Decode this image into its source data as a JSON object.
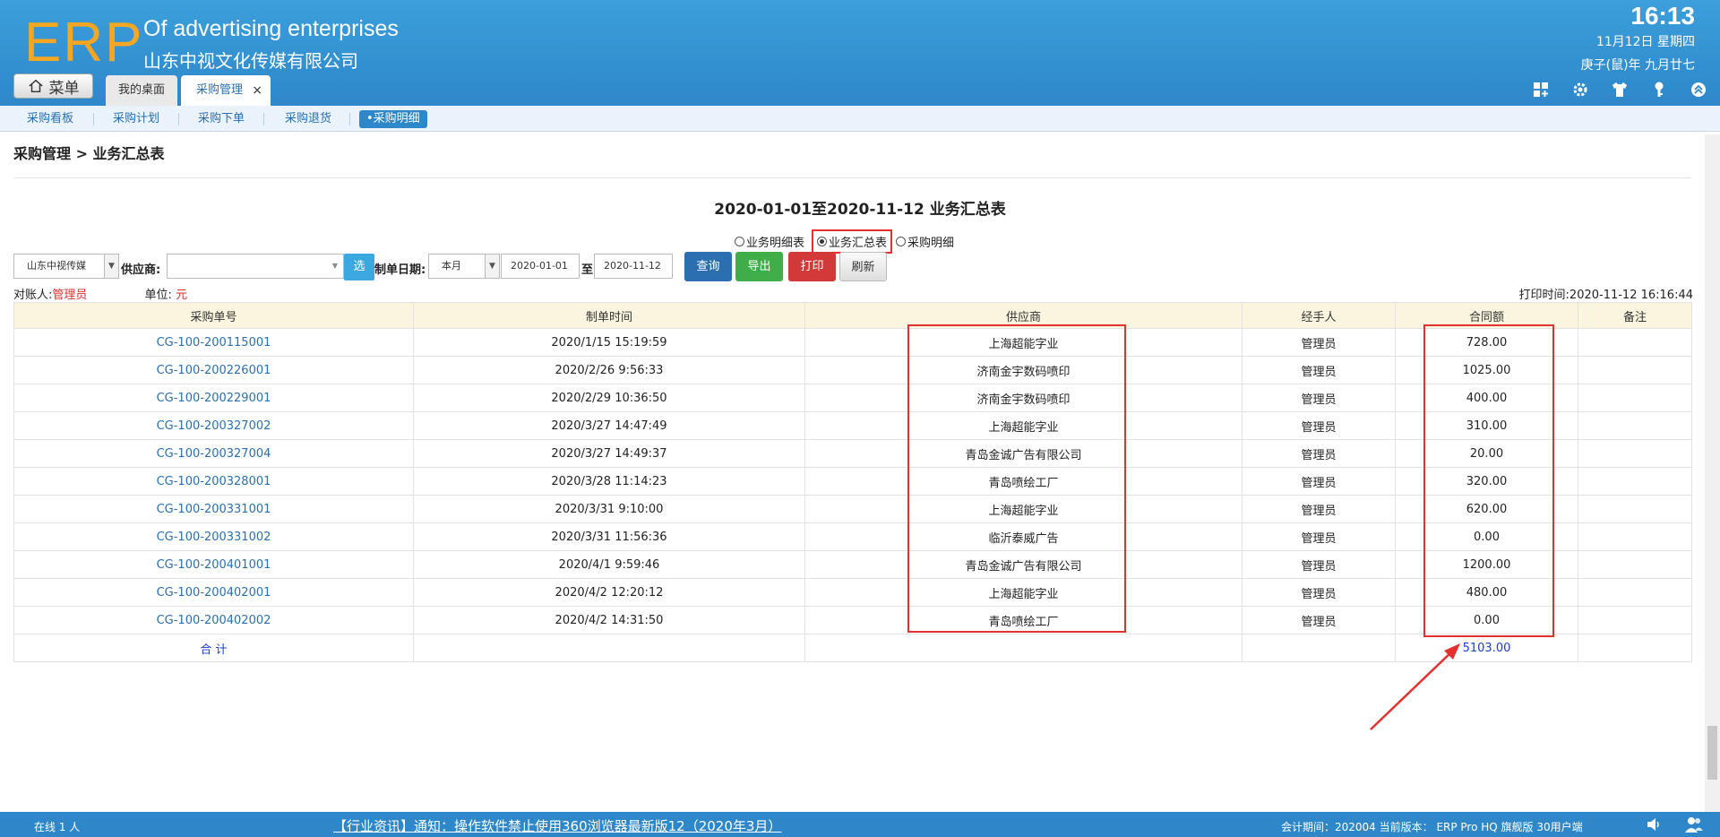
{
  "header": {
    "logo": "ERP",
    "brand_en": "Of advertising enterprises",
    "brand_cn": "山东中视文化传媒有限公司",
    "time": "16:13",
    "date": "11月12日 星期四",
    "lunar": "庚子(鼠)年 九月廿七",
    "menu_label": "菜单",
    "tabs": [
      {
        "label": "我的桌面"
      },
      {
        "label": "采购管理",
        "close": "×"
      }
    ],
    "tool_icons": [
      "grid-add-icon",
      "gear-icon",
      "shirt-icon",
      "key-icon",
      "collapse-up-icon"
    ]
  },
  "subnav": {
    "items": [
      {
        "label": "采购看板"
      },
      {
        "label": "采购计划"
      },
      {
        "label": "采购下单"
      },
      {
        "label": "采购退货"
      },
      {
        "label": "•采购明细"
      }
    ]
  },
  "breadcrumb": "采购管理 > 业务汇总表",
  "report_title": "2020-01-01至2020-11-12 业务汇总表",
  "view_options": [
    {
      "label": "业务明细表",
      "selected": false
    },
    {
      "label": "业务汇总表",
      "selected": true
    },
    {
      "label": "采购明细",
      "selected": false
    }
  ],
  "filters": {
    "company": "山东中视传媒",
    "supplier_label": "供应商:",
    "supplier_value": "",
    "pick_label": "选",
    "date_label": "制单日期:",
    "period": "本月",
    "date_from": "2020-01-01",
    "to_label": "至",
    "date_to": "2020-11-12"
  },
  "buttons": {
    "query": "查询",
    "export": "导出",
    "print": "打印",
    "refresh": "刷新"
  },
  "meta": {
    "account_label": "对账人:",
    "account_value": "管理员",
    "unit_label": "单位:",
    "unit_value": "元",
    "print_time": "打印时间:2020-11-12 16:16:44"
  },
  "table": {
    "columns": [
      "采购单号",
      "制单时间",
      "供应商",
      "经手人",
      "合同额",
      "备注"
    ],
    "rows": [
      [
        "CG-100-200115001",
        "2020/1/15 15:19:59",
        "上海超能字业",
        "管理员",
        "728.00",
        ""
      ],
      [
        "CG-100-200226001",
        "2020/2/26 9:56:33",
        "济南金宇数码喷印",
        "管理员",
        "1025.00",
        ""
      ],
      [
        "CG-100-200229001",
        "2020/2/29 10:36:50",
        "济南金宇数码喷印",
        "管理员",
        "400.00",
        ""
      ],
      [
        "CG-100-200327002",
        "2020/3/27 14:47:49",
        "上海超能字业",
        "管理员",
        "310.00",
        ""
      ],
      [
        "CG-100-200327004",
        "2020/3/27 14:49:37",
        "青岛金诚广告有限公司",
        "管理员",
        "20.00",
        ""
      ],
      [
        "CG-100-200328001",
        "2020/3/28 11:14:23",
        "青岛喷绘工厂",
        "管理员",
        "320.00",
        ""
      ],
      [
        "CG-100-200331001",
        "2020/3/31 9:10:00",
        "上海超能字业",
        "管理员",
        "620.00",
        ""
      ],
      [
        "CG-100-200331002",
        "2020/3/31 11:56:36",
        "临沂泰威广告",
        "管理员",
        "0.00",
        ""
      ],
      [
        "CG-100-200401001",
        "2020/4/1 9:59:46",
        "青岛金诚广告有限公司",
        "管理员",
        "1200.00",
        ""
      ],
      [
        "CG-100-200402001",
        "2020/4/2 12:20:12",
        "上海超能字业",
        "管理员",
        "480.00",
        ""
      ],
      [
        "CG-100-200402002",
        "2020/4/2 14:31:50",
        "青岛喷绘工厂",
        "管理员",
        "0.00",
        ""
      ]
    ],
    "total_label": "合 计",
    "total_value": "5103.00"
  },
  "footer": {
    "online": "在线   1   人",
    "news": "【行业资讯】通知：操作软件禁止使用360浏览器最新版12（2020年3月）",
    "version": "会计期间：202004 当前版本：  ERP Pro HQ 旗舰版 30用户端"
  },
  "colors": {
    "header": "#2e87c9",
    "logo": "#f5a623",
    "highlight": "#e2312f",
    "link": "#2a6fb0"
  }
}
